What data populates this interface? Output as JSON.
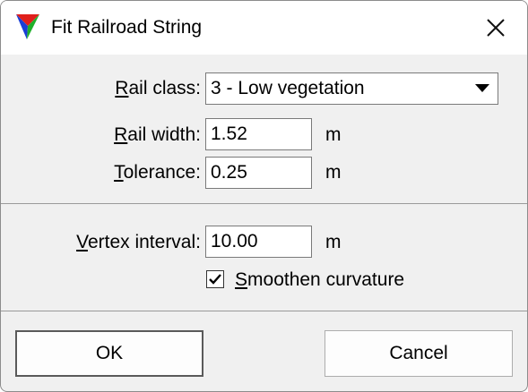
{
  "window": {
    "title": "Fit Railroad String"
  },
  "rail_class": {
    "label_u": "R",
    "label_rest": "ail class:",
    "value": "3 - Low vegetation"
  },
  "rail_width": {
    "label_u": "R",
    "label_rest": "ail width:",
    "value": "1.52",
    "unit": "m"
  },
  "tolerance": {
    "label_u": "T",
    "label_rest": "olerance:",
    "value": "0.25",
    "unit": "m"
  },
  "vertex_interval": {
    "label_u": "V",
    "label_rest": "ertex interval:",
    "value": "10.00",
    "unit": "m"
  },
  "smoothen": {
    "label_u": "S",
    "label_rest": "moothen curvature",
    "checked": true
  },
  "buttons": {
    "ok": "OK",
    "cancel": "Cancel"
  }
}
